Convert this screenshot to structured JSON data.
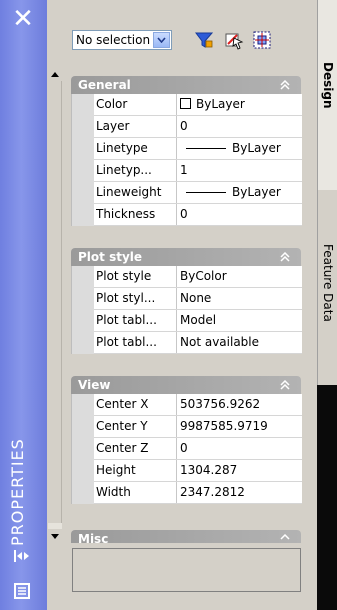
{
  "palette": {
    "title_strip": "#7e8de6",
    "panel_bg": "#d4d0c8",
    "section_header": "#a5a5a5"
  },
  "title": "PROPERTIES",
  "toolbar": {
    "selection": "No selection",
    "buttons": [
      {
        "name": "toggle-pickadd-button",
        "icon": "funnel-icon"
      },
      {
        "name": "select-objects-button",
        "icon": "select-objects-icon"
      },
      {
        "name": "quick-select-button",
        "icon": "quick-select-icon"
      }
    ]
  },
  "sections": {
    "general": {
      "title": "General",
      "rows": [
        {
          "name": "Color",
          "value": "ByLayer"
        },
        {
          "name": "Layer",
          "value": "0"
        },
        {
          "name": "Linetype",
          "value": "ByLayer"
        },
        {
          "name": "Linetyp...",
          "value": "1"
        },
        {
          "name": "Lineweight",
          "value": "ByLayer"
        },
        {
          "name": "Thickness",
          "value": "0"
        }
      ]
    },
    "plot_style": {
      "title": "Plot style",
      "rows": [
        {
          "name": "Plot style",
          "value": "ByColor"
        },
        {
          "name": "Plot styl...",
          "value": "None"
        },
        {
          "name": "Plot tabl...",
          "value": "Model"
        },
        {
          "name": "Plot tabl...",
          "value": "Not available"
        }
      ]
    },
    "view": {
      "title": "View",
      "rows": [
        {
          "name": "Center X",
          "value": "503756.9262"
        },
        {
          "name": "Center Y",
          "value": "9987585.9719"
        },
        {
          "name": "Center Z",
          "value": "0"
        },
        {
          "name": "Height",
          "value": "1304.287"
        },
        {
          "name": "Width",
          "value": "2347.2812"
        }
      ]
    },
    "misc": {
      "title": "Misc"
    }
  },
  "right_tabs": [
    "Design",
    "Feature Data"
  ]
}
